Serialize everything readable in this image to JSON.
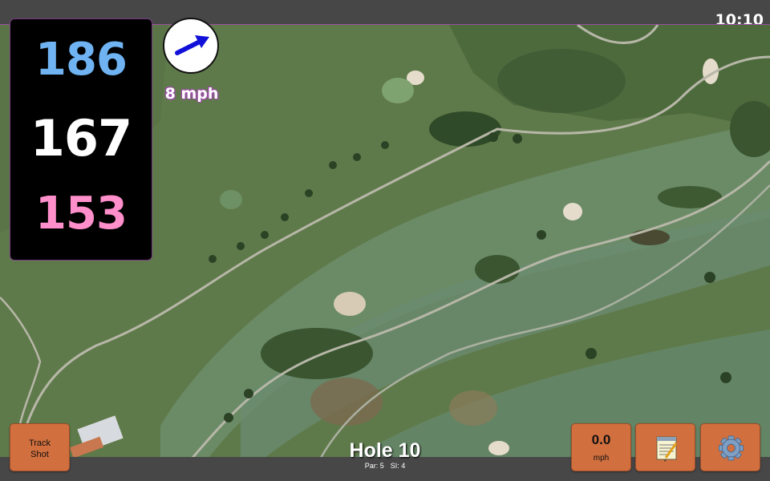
{
  "status_bar": {
    "time": "10:10"
  },
  "distances": {
    "back": "186",
    "middle": "167",
    "front": "153"
  },
  "wind": {
    "speed": "8 mph",
    "direction_icon": "arrow-wind-icon"
  },
  "hole": {
    "title": "Hole 10",
    "par": "Par: 5",
    "stroke_index": "SI: 4"
  },
  "buttons": {
    "track_shot_line1": "Track",
    "track_shot_line2": "Shot",
    "speed_value": "0.0",
    "speed_unit": "mph",
    "notes_icon": "notepad-icon",
    "settings_icon": "gear-icon"
  },
  "colors": {
    "accent_button": "#d16f3e",
    "back_distance": "#6fb3f2",
    "front_distance": "#ff8fcb",
    "frame_accent": "#9b4ea0"
  }
}
